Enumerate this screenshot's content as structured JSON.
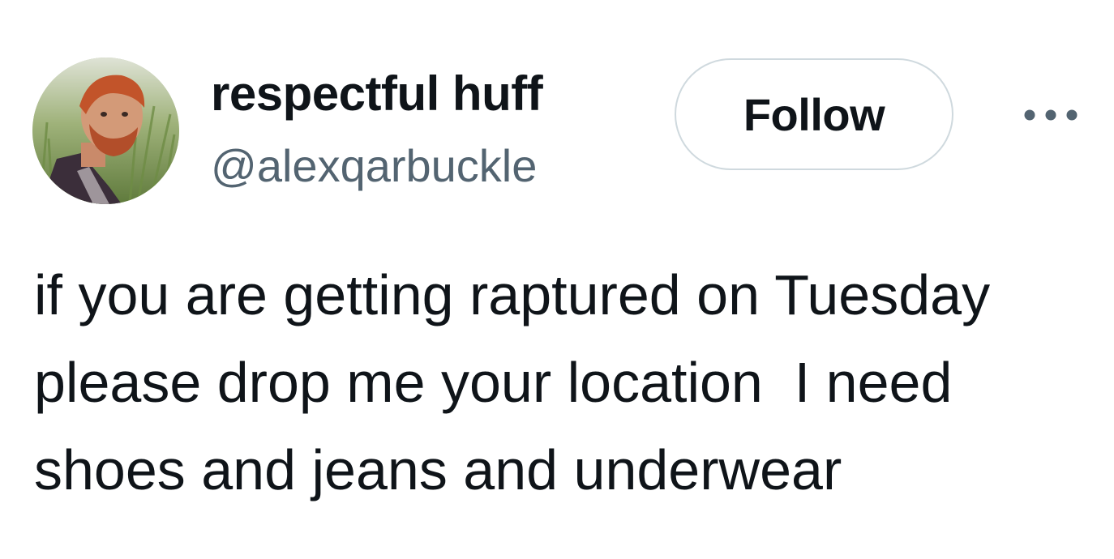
{
  "author": {
    "display_name": "respectful huff",
    "handle": "@alexqarbuckle",
    "avatar_icon": "profile-photo"
  },
  "actions": {
    "follow_label": "Follow",
    "more_icon": "ellipsis-icon"
  },
  "tweet": {
    "lines": [
      "if you are getting raptured on Tuesday",
      "please drop me your location  I need",
      "shoes and jeans and underwear"
    ]
  },
  "colors": {
    "text_primary": "#0f1419",
    "text_secondary": "#536471",
    "border": "#cfd9de",
    "background": "#ffffff"
  }
}
